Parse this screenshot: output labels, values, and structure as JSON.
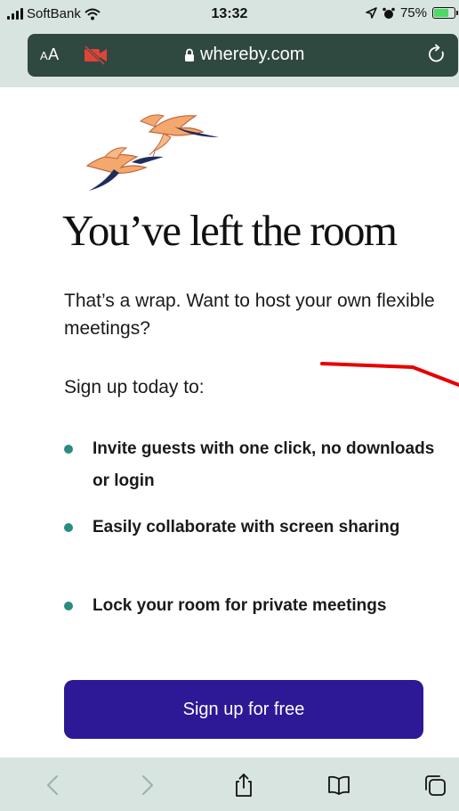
{
  "status_bar": {
    "carrier": "SoftBank",
    "time": "13:32",
    "battery_percent": "75%",
    "battery_level": 0.75,
    "icons": [
      "signal-icon",
      "wifi-icon",
      "location-icon",
      "alarm-icon",
      "battery-icon"
    ]
  },
  "browser": {
    "text_size_label": "AA",
    "url": "whereby.com",
    "icons": [
      "camera-off-icon",
      "lock-icon",
      "reload-icon"
    ]
  },
  "page": {
    "title": "You’ve left the room",
    "intro": "That’s a wrap. Want to host your own flexible meetings?",
    "signup_lead": "Sign up today to:",
    "benefits": [
      "Invite guests with one click, no downloads or login",
      "Easily collaborate with screen sharing",
      "Lock your room for private meetings"
    ],
    "cta_label": "Sign up for free"
  },
  "toolbar": {
    "icons": [
      "back-icon",
      "forward-icon",
      "share-icon",
      "bookmarks-icon",
      "tabs-icon"
    ]
  },
  "colors": {
    "chrome_bg": "#d8e4df",
    "url_bar_bg": "#2f4941",
    "cta_bg": "#2d1896",
    "bullet": "#2a8c7e",
    "annotation_red": "#e60000",
    "camera_off_red": "#e0433a"
  }
}
